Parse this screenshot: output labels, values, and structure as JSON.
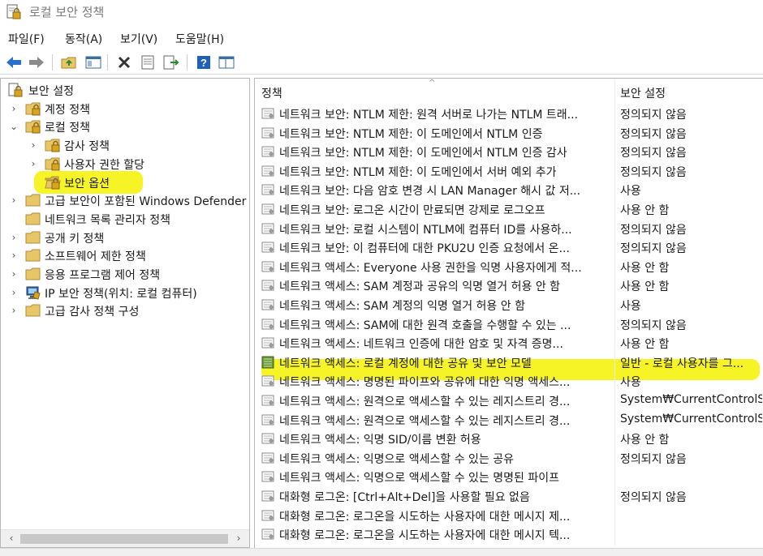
{
  "window": {
    "title": "로컬 보안 정책"
  },
  "menu": [
    "파일(F)",
    "동작(A)",
    "보기(V)",
    "도움말(H)"
  ],
  "toolbar": {
    "buttons": [
      "back-arrow-icon",
      "forward-arrow-icon",
      "up-folder-icon",
      "show-hide-tree-icon",
      "delete-icon",
      "properties-icon",
      "export-list-icon",
      "help-icon",
      "view-icon"
    ]
  },
  "tree": {
    "root": "보안 설정",
    "items": [
      {
        "label": "계정 정책",
        "twist": "›",
        "icon": "folder-lock-icon"
      },
      {
        "label": "로컬 정책",
        "twist": "⌄",
        "icon": "folder-lock-icon"
      },
      {
        "label": "감사 정책",
        "twist": "›",
        "icon": "folder-lock-icon"
      },
      {
        "label": "사용자 권한 할당",
        "twist": "›",
        "icon": "folder-lock-icon"
      },
      {
        "label": "보안 옵션",
        "twist": "",
        "icon": "folder-open-icon"
      },
      {
        "label": "고급 보안이 포함된 Windows Defender",
        "twist": "›",
        "icon": "folder-icon"
      },
      {
        "label": "네트워크 목록 관리자 정책",
        "twist": "",
        "icon": "folder-icon"
      },
      {
        "label": "공개 키 정책",
        "twist": "›",
        "icon": "folder-icon"
      },
      {
        "label": "소프트웨어 제한 정책",
        "twist": "›",
        "icon": "folder-icon"
      },
      {
        "label": "응용 프로그램 제어 정책",
        "twist": "›",
        "icon": "folder-icon"
      },
      {
        "label": "IP 보안 정책(위치: 로컬 컴퓨터)",
        "twist": "›",
        "icon": "ip-security-icon"
      },
      {
        "label": "고급 감사 정책 구성",
        "twist": "›",
        "icon": "folder-icon"
      }
    ],
    "scroll_left": "‹",
    "scroll_right": "›"
  },
  "list": {
    "col_policy": "정책",
    "col_setting": "보안 설정",
    "rows": [
      {
        "name": "네트워크 보안: NTLM 제한: 원격 서버로 나가는 NTLM 트래...",
        "value": "정의되지 않음"
      },
      {
        "name": "네트워크 보안: NTLM 제한: 이 도메인에서 NTLM 인증",
        "value": "정의되지 않음"
      },
      {
        "name": "네트워크 보안: NTLM 제한: 이 도메인에서 NTLM 인증 감사",
        "value": "정의되지 않음"
      },
      {
        "name": "네트워크 보안: NTLM 제한: 이 도메인에서 서버 예외 추가",
        "value": "정의되지 않음"
      },
      {
        "name": "네트워크 보안: 다음 암호 변경 시 LAN Manager 해시 값 저...",
        "value": "사용"
      },
      {
        "name": "네트워크 보안: 로그온 시간이 만료되면 강제로 로그오프",
        "value": "사용 안 함"
      },
      {
        "name": "네트워크 보안: 로컬 시스템이 NTLM에 컴퓨터 ID를 사용하...",
        "value": "정의되지 않음"
      },
      {
        "name": "네트워크 보안: 이 컴퓨터에 대한 PKU2U 인증 요청에서 온...",
        "value": "정의되지 않음"
      },
      {
        "name": "네트워크 액세스: Everyone 사용 권한을 익명 사용자에게 적...",
        "value": "사용 안 함"
      },
      {
        "name": "네트워크 액세스: SAM 계정과 공유의 익명 열거 허용 안 함",
        "value": "사용 안 함"
      },
      {
        "name": "네트워크 액세스: SAM 계정의 익명 열거 허용 안 함",
        "value": "사용"
      },
      {
        "name": "네트워크 액세스: SAM에 대한 원격 호출을 수행할 수 있는 ...",
        "value": "정의되지 않음"
      },
      {
        "name": "네트워크 액세스: 네트워크 인증에 대한 암호 및 자격 증명...",
        "value": "사용 안 함"
      },
      {
        "name": "네트워크 액세스: 로컬 계정에 대한 공유 및 보안 모델",
        "value": "일반 - 로컬 사용자를 그..."
      },
      {
        "name": "네트워크 액세스: 명명된 파이프와 공유에 대한 익명 액세스...",
        "value": "사용"
      },
      {
        "name": "네트워크 액세스: 원격으로 액세스할 수 있는 레지스트리 경...",
        "value": "System₩CurrentControlS..."
      },
      {
        "name": "네트워크 액세스: 원격으로 액세스할 수 있는 레지스트리 경...",
        "value": "System₩CurrentControlS..."
      },
      {
        "name": "네트워크 액세스: 익명 SID/이름 변환 허용",
        "value": "사용 안 함"
      },
      {
        "name": "네트워크 액세스: 익명으로 액세스할 수 있는 공유",
        "value": "정의되지 않음"
      },
      {
        "name": "네트워크 액세스: 익명으로 액세스할 수 있는 명명된 파이프",
        "value": ""
      },
      {
        "name": "대화형 로그온: [Ctrl+Alt+Del]을 사용할 필요 없음",
        "value": "정의되지 않음"
      },
      {
        "name": "대화형 로그온: 로그온을 시도하는 사용자에 대한 메시지 제...",
        "value": ""
      },
      {
        "name": "대화형 로그온: 로그온을 시도하는 사용자에 대한 메시지 텍...",
        "value": ""
      }
    ]
  },
  "colors": {
    "highlight": "#f6f31a",
    "folder": "#e8c667",
    "lock": "#d9a521"
  }
}
